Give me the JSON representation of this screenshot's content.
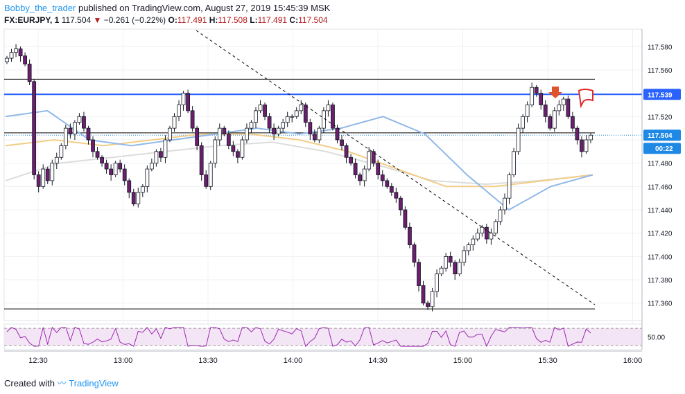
{
  "header": {
    "author": "Bobby_the_trader",
    "published_text": "published on TradingView.com, August 27, 2019 15:45:39 MSK",
    "symbol": "FX:EURJPY, 1",
    "last": "117.504",
    "change_arrow": "▼",
    "change": "−0.261 (−0.22%)",
    "open_label": "O:",
    "open": "117.491",
    "high_label": "H:",
    "high": "117.508",
    "low_label": "L:",
    "low": "117.491",
    "close_label": "C:",
    "close": "117.504"
  },
  "price_badges": [
    {
      "label": "117.539",
      "value": 117.539,
      "color": "#2962ff"
    },
    {
      "label": "117.504",
      "value": 117.504,
      "color": "#1e88e5"
    }
  ],
  "countdown": "00:22",
  "rsi_label": "50.00",
  "footer": {
    "created_with": "Created with",
    "brand": "TradingView"
  },
  "colors": {
    "up_candle": "#ffffff",
    "down_candle": "#6b1f6e",
    "wick": "#131722",
    "horizontal_line": "#000000",
    "blue_level": "#2962ff",
    "ma_fast": "#90b8e8",
    "ma_mid": "#f2cd86",
    "ma_slow": "#dcdcdc",
    "rsi_line": "#9c27b0",
    "rsi_band": "#f3e5f5",
    "arrow_marker": "#e0522b",
    "flag_marker": "#e0292b"
  },
  "chart_data": {
    "type": "candlestick",
    "ylim": [
      117.345,
      117.595
    ],
    "yticks": [
      117.58,
      117.56,
      117.54,
      117.52,
      117.5,
      117.48,
      117.46,
      117.44,
      117.42,
      117.4,
      117.38,
      117.36
    ],
    "ytick_labels": [
      "117.580",
      "117.560",
      "117.520",
      "117.480",
      "117.460",
      "117.440",
      "117.420",
      "117.400",
      "117.380",
      "117.360"
    ],
    "xlim_minutes": [
      12,
      199
    ],
    "xticks": [
      {
        "label": "12:30",
        "min": 30
      },
      {
        "label": "13:00",
        "min": 60
      },
      {
        "label": "13:30",
        "min": 90
      },
      {
        "label": "14:00",
        "min": 120
      },
      {
        "label": "14:30",
        "min": 150
      },
      {
        "label": "15:00",
        "min": 180
      },
      {
        "label": "15:30",
        "min": 210
      },
      {
        "label": "16:00",
        "min": 240
      }
    ],
    "horizontal_levels": [
      {
        "value": 117.552,
        "style": "black"
      },
      {
        "value": 117.539,
        "style": "blue"
      },
      {
        "value": 117.506,
        "style": "black"
      },
      {
        "value": 117.355,
        "style": "black"
      }
    ],
    "candles_close": [
      117.57,
      117.575,
      117.578,
      117.572,
      117.565,
      117.55,
      117.47,
      117.46,
      117.475,
      117.465,
      117.48,
      117.485,
      117.495,
      117.51,
      117.505,
      117.515,
      117.52,
      117.51,
      117.5,
      117.49,
      117.485,
      117.48,
      117.475,
      117.47,
      117.48,
      117.475,
      117.465,
      117.455,
      117.445,
      117.455,
      117.46,
      117.475,
      117.48,
      117.49,
      117.485,
      117.5,
      117.51,
      117.52,
      117.53,
      117.54,
      117.525,
      117.51,
      117.495,
      117.47,
      117.46,
      117.48,
      117.5,
      117.51,
      117.505,
      117.495,
      117.49,
      117.485,
      117.5,
      117.51,
      117.515,
      117.525,
      117.53,
      117.52,
      117.51,
      117.505,
      117.51,
      117.515,
      117.52,
      117.52,
      117.525,
      117.53,
      117.515,
      117.505,
      117.5,
      117.51,
      117.525,
      117.53,
      117.51,
      117.5,
      117.495,
      117.485,
      117.48,
      117.47,
      117.465,
      117.475,
      117.49,
      117.48,
      117.47,
      117.465,
      117.46,
      117.455,
      117.45,
      117.44,
      117.425,
      117.41,
      117.395,
      117.375,
      117.36,
      117.357,
      117.37,
      117.385,
      117.39,
      117.4,
      117.395,
      117.385,
      117.395,
      117.405,
      117.41,
      117.415,
      117.42,
      117.425,
      117.415,
      117.42,
      117.43,
      117.44,
      117.45,
      117.47,
      117.49,
      117.51,
      117.52,
      117.53,
      117.545,
      117.54,
      117.53,
      117.52,
      117.51,
      117.525,
      117.53,
      117.535,
      117.52,
      117.51,
      117.5,
      117.49,
      117.5,
      117.504
    ],
    "ma_fast_sample": [
      117.52,
      117.525,
      117.5,
      117.495,
      117.5,
      117.505,
      117.51,
      117.505,
      117.51,
      117.52,
      117.505,
      117.47,
      117.44,
      117.46,
      117.47
    ],
    "ma_mid_sample": [
      117.495,
      117.5,
      117.495,
      117.5,
      117.505,
      117.505,
      117.5,
      117.49,
      117.475,
      117.46,
      117.46,
      117.465,
      117.47
    ],
    "ma_slow_sample": [
      117.465,
      117.48,
      117.485,
      117.49,
      117.495,
      117.498,
      117.49,
      117.478,
      117.465,
      117.462,
      117.465,
      117.47
    ],
    "rsi": {
      "ylim": [
        20,
        80
      ],
      "level_upper": 70,
      "level_lower": 30,
      "mid": 50
    }
  }
}
